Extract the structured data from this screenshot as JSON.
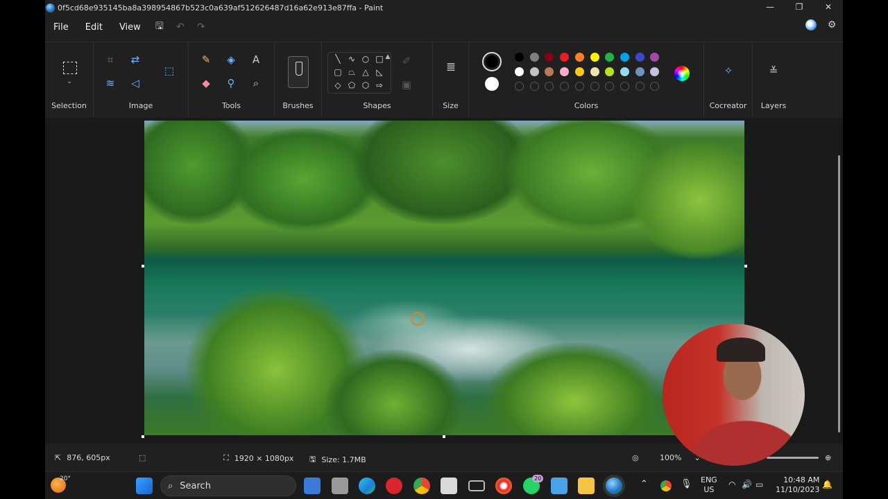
{
  "window": {
    "title": "0f5cd68e935145ba8a398954867b523c0a639af512626487d16a62e913e87ffa - Paint",
    "minimize": "—",
    "maximize": "❐",
    "close": "✕"
  },
  "menu": {
    "file": "File",
    "edit": "Edit",
    "view": "View"
  },
  "ribbon": {
    "selection": "Selection",
    "image": "Image",
    "tools": "Tools",
    "brushes": "Brushes",
    "shapes": "Shapes",
    "size": "Size",
    "colors": "Colors",
    "cocreator": "Cocreator",
    "layers": "Layers"
  },
  "colors": {
    "primary": "#000000",
    "secondary": "#ffffff",
    "palette_row1": [
      "#000000",
      "#7f7f7f",
      "#880015",
      "#ed1c24",
      "#ff7f27",
      "#fff200",
      "#22b14c",
      "#00a2e8",
      "#3f48cc",
      "#a349a4"
    ],
    "palette_row2": [
      "#ffffff",
      "#c3c3c3",
      "#b97a57",
      "#ffaec9",
      "#ffc90e",
      "#efe4b0",
      "#b5e61d",
      "#99d9ea",
      "#7092be",
      "#c8bfe7"
    ]
  },
  "status": {
    "cursor_pos": "876, 605px",
    "canvas_size": "1920 × 1080px",
    "file_size": "Size: 1.7MB",
    "zoom": "100%"
  },
  "taskbar": {
    "weather_temp": "20°",
    "search_label": "Search",
    "whatsapp_badge": "20",
    "lang_line1": "ENG",
    "lang_line2": "US",
    "time": "10:48 AM",
    "date": "11/10/2023"
  }
}
